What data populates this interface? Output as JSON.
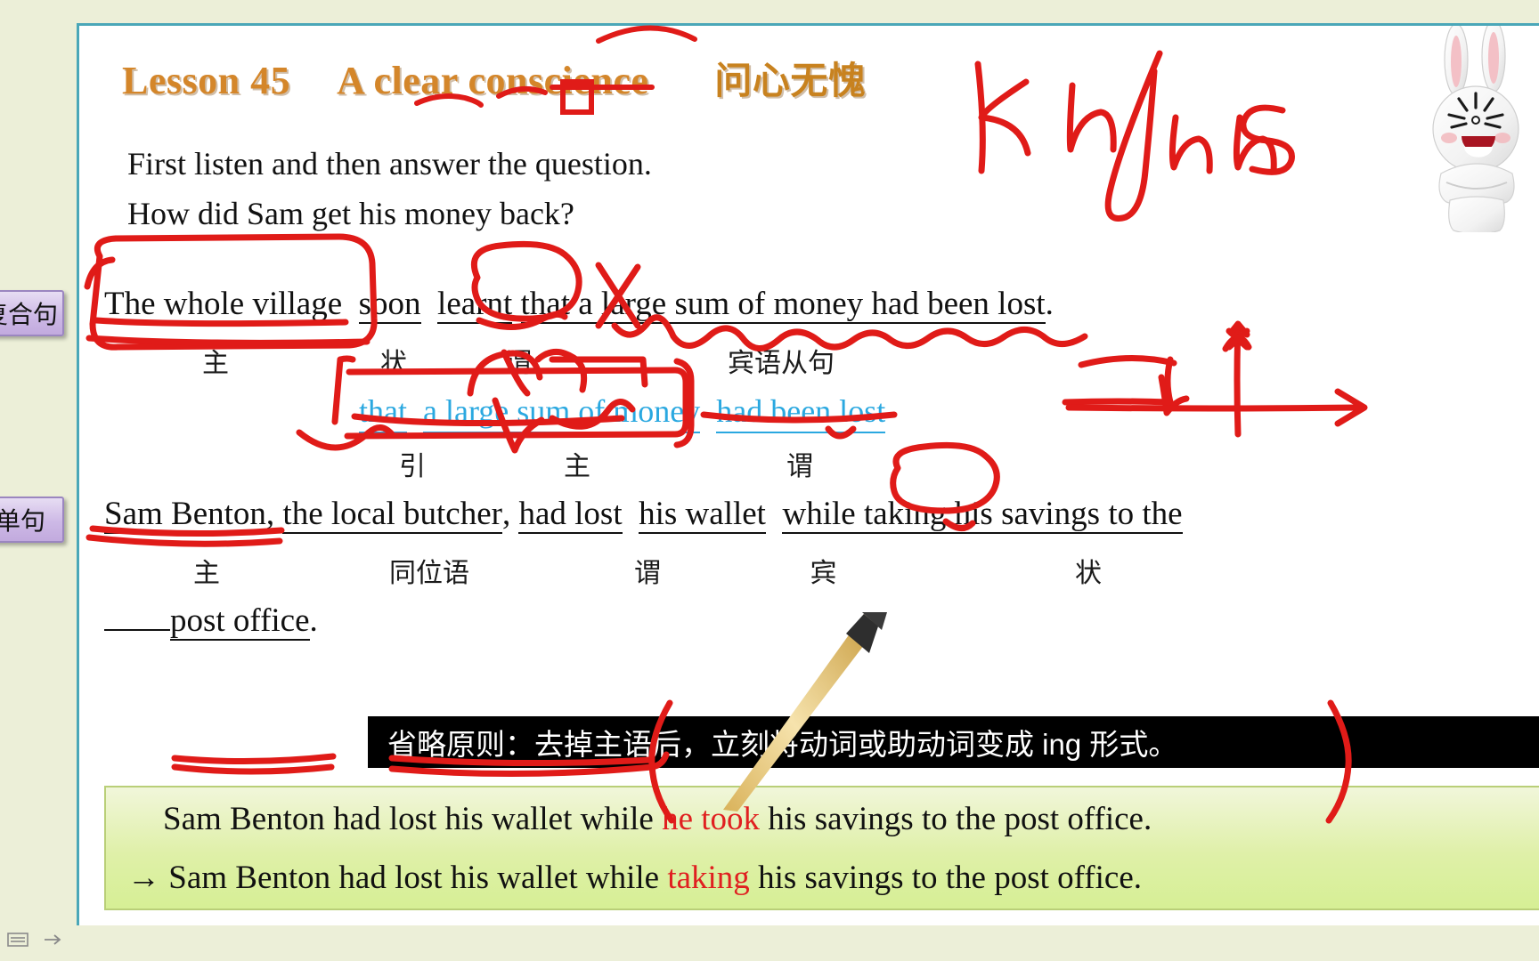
{
  "slide": {
    "title": {
      "lesson": "Lesson 45",
      "english": "A clear conscience",
      "chinese": "问心无愧"
    },
    "intro": [
      "First listen and then answer the question.",
      "How did Sam get his money back?"
    ],
    "complex_sentence": {
      "segments": [
        "The whole village",
        "soon",
        "learnt",
        "that a large sum of money had been lost",
        "."
      ],
      "labels": [
        "主",
        "状",
        "谓",
        "宾语从句"
      ]
    },
    "clause": {
      "segments": [
        "that",
        "a large  sum of money",
        "had been lost"
      ],
      "labels": [
        "引",
        "主",
        "谓"
      ]
    },
    "simple_sentence": {
      "segments": [
        "Sam Benton",
        ", ",
        "the local butcher",
        ", ",
        "had lost",
        "his wallet",
        "while taking his savings to the"
      ],
      "continuation": "post office",
      "period": ".",
      "labels": [
        "主",
        "同位语",
        "谓",
        "宾",
        "状"
      ]
    },
    "banner": "省略原则：去掉主语后，立刻将动词或助动词变成 ing 形式。",
    "result_box": {
      "line1_before": "Sam Benton had lost  his wallet while ",
      "line1_highlight": "he took",
      "line1_after": " his savings to the post office.",
      "line2_arrow": "→ ",
      "line2_before": "Sam Benton had lost  his wallet while ",
      "line2_highlight": "taking",
      "line2_after": " his savings to the post office."
    },
    "handwriting": {
      "phonetic": "kɔnʃəns"
    }
  },
  "side_tabs": [
    {
      "name": "tab-complex-sentence",
      "label": "复合句"
    },
    {
      "name": "tab-simple-sentence",
      "label": "单句"
    }
  ],
  "colors": {
    "title_orange": "#d4862a",
    "clause_blue": "#2aa8e0",
    "ink_red": "#e01b18",
    "banner_bg": "#000000",
    "frame_teal": "#4aa7b8",
    "page_bg": "#ecefd8"
  },
  "chart_data": null
}
